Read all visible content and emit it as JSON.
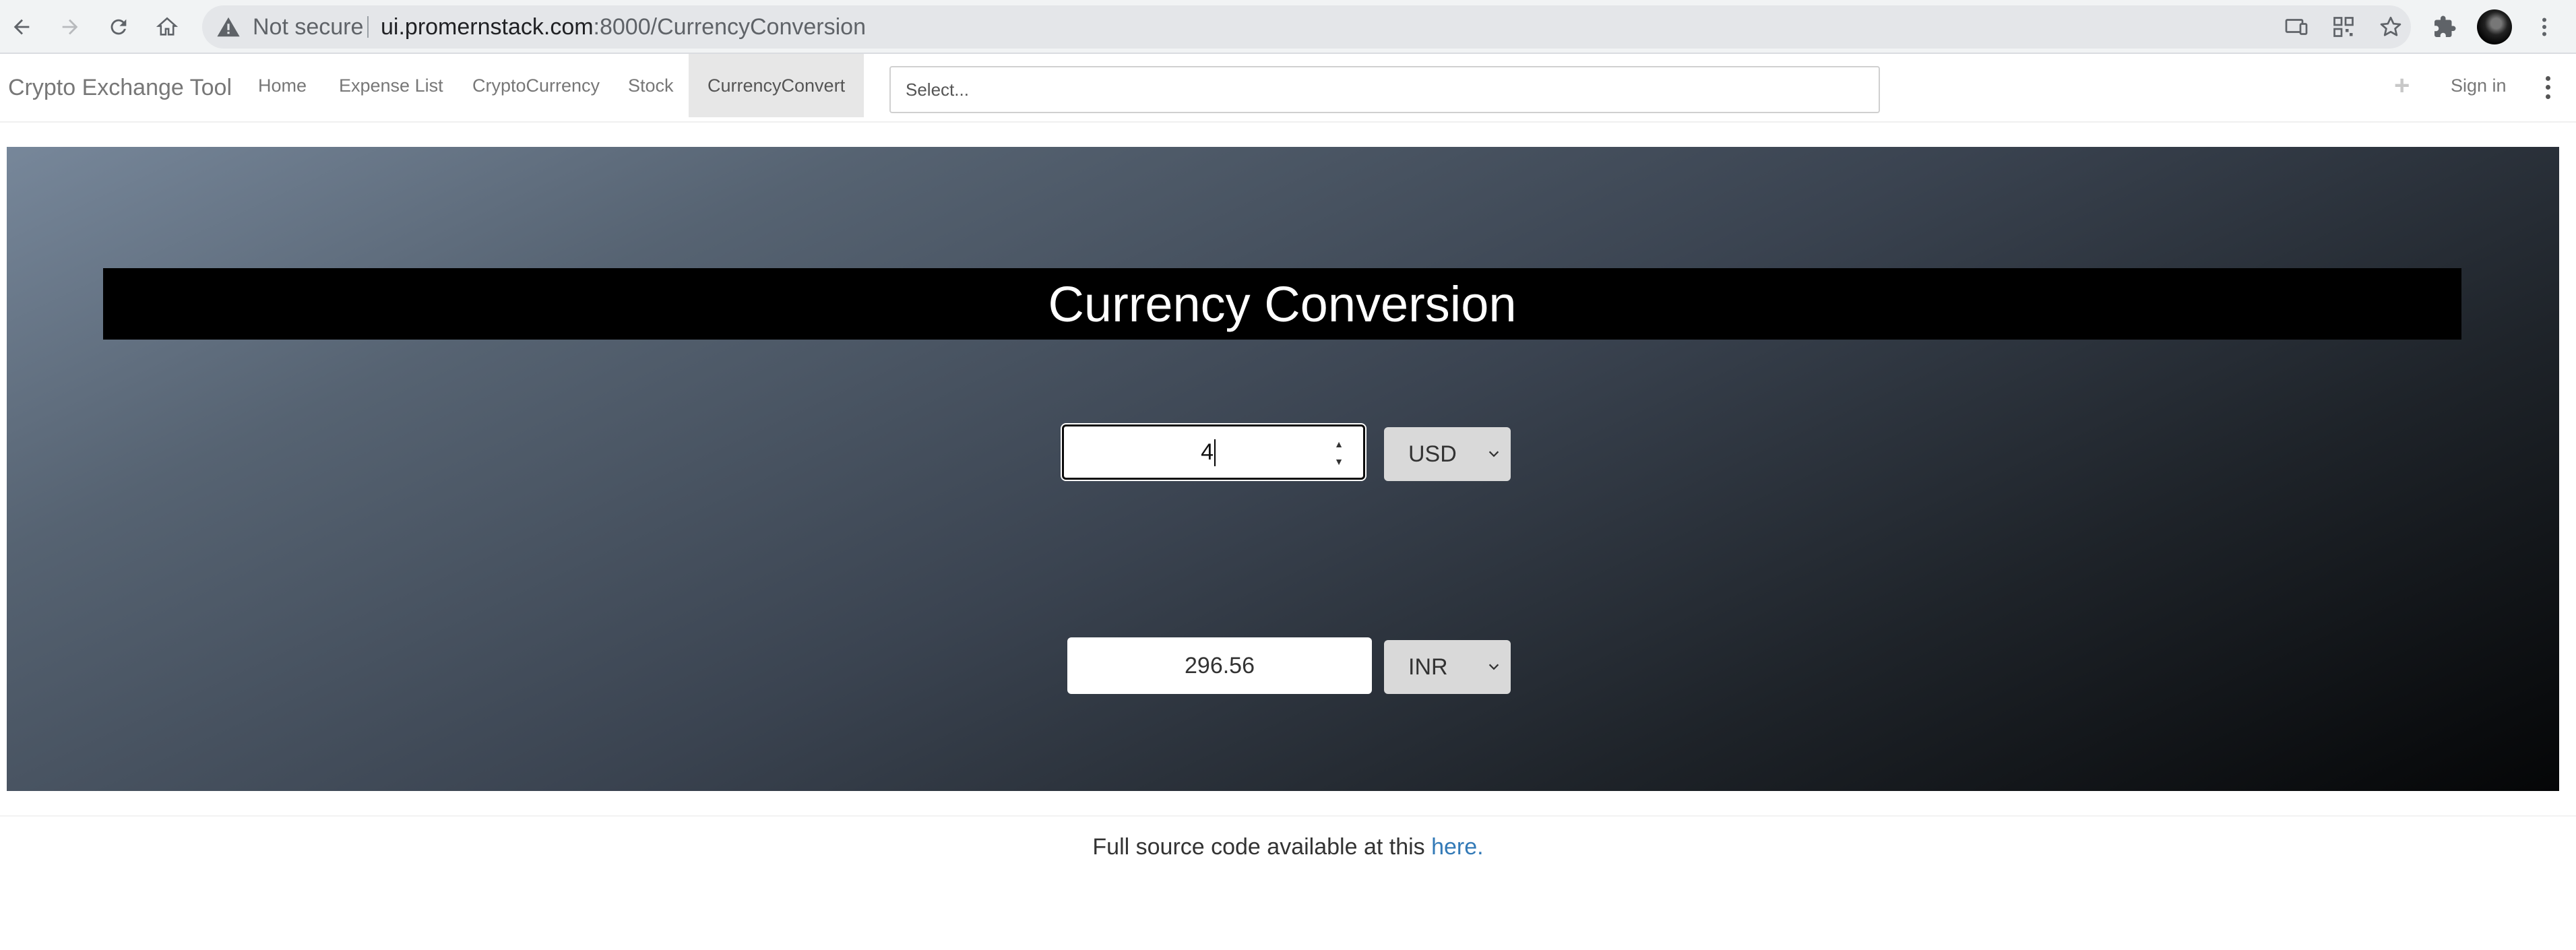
{
  "browser": {
    "security_label": "Not secure",
    "url_host": "ui.promernstack.com",
    "url_rest": ":8000/CurrencyConversion"
  },
  "navbar": {
    "brand": "Crypto Exchange Tool",
    "links": [
      "Home",
      "Expense List",
      "CryptoCurrency",
      "Stock",
      "CurrencyConvert"
    ],
    "active": "CurrencyConvert",
    "search_placeholder": "Select...",
    "plus_glyph": "+",
    "sign_in": "Sign in"
  },
  "converter": {
    "title": "Currency Conversion",
    "amount": "4",
    "from_currency": "USD",
    "result": "296.56",
    "to_currency": "INR"
  },
  "footer": {
    "text": "Full source code available at this",
    "link": "here."
  },
  "icons": [
    "back-arrow-icon",
    "forward-arrow-icon",
    "reload-icon",
    "home-icon",
    "warning-icon",
    "cast-icon",
    "qr-code-icon",
    "star-icon",
    "extensions-icon",
    "avatar",
    "kebab-menu-icon",
    "chevron-down-icon"
  ]
}
